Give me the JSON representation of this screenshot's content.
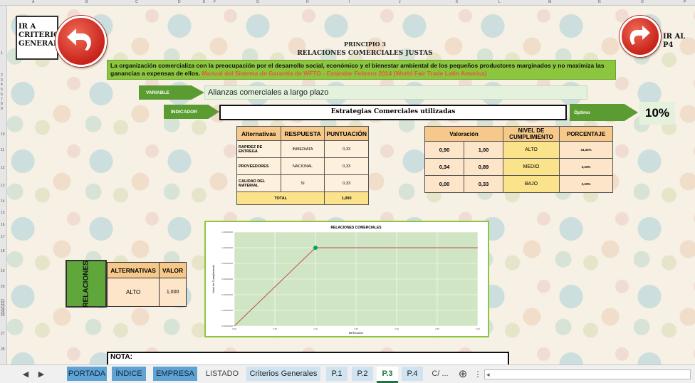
{
  "columns": [
    "A",
    "B",
    "C",
    "D",
    "E",
    "F",
    "G",
    "H",
    "I",
    "J",
    "K",
    "L",
    "M",
    "N",
    "O",
    "P"
  ],
  "rows": [
    "1",
    "2",
    "3",
    "4",
    "5",
    "6",
    "7",
    "8",
    "9",
    "10",
    "11",
    "12",
    "13",
    "14",
    "15",
    "16",
    "17",
    "18",
    "19",
    "20",
    "21",
    "22",
    "23",
    "24",
    "25",
    "26",
    "27",
    "28"
  ],
  "nav": {
    "left_label": "IR A CRITERIOS GENERALES",
    "right_label": "IR AL P4"
  },
  "header": {
    "principle": "PRINCIPIO 3",
    "title": "RELACIONES COMERCIALES JUSTAS"
  },
  "description": {
    "text": "La organización comercializa con la preocupación por el desarrollo social, económico y el bienestar ambiental de los pequeños productores marginados y no maximiza las ganancias a expensas de ellos.",
    "reference": " Manual del Sistema de Garantía de WFTO - Estándar Febrero 2014 (World Fair Trade Latin America)"
  },
  "variable": {
    "label": "VARIABLE",
    "value": "Alianzas comerciales a largo plazo"
  },
  "indicator": {
    "label": "INDICADOR",
    "value": "Estrategias Comerciales utilizadas",
    "optimo_label": "Óptimo",
    "optimo_value": "10%"
  },
  "alternatives_table": {
    "headers": [
      "Alternativas",
      "RESPUESTA",
      "PUNTUACIÓN"
    ],
    "rows": [
      {
        "alt": "RAPIDEZ DE ENTREGA",
        "resp": "INMEDIATA",
        "score": "0,33"
      },
      {
        "alt": "PROVEEDORES",
        "resp": "NACIONAL",
        "score": "0,33"
      },
      {
        "alt": "CALIDAD DEL MATERIAL",
        "resp": "SI",
        "score": "0,33"
      }
    ],
    "total_label": "TOTAL",
    "total_value": "1,000"
  },
  "valuation_table": {
    "headers": [
      "Valoración",
      "NIVEL DE CUMPLIMIENTO",
      "PORCENTAJE"
    ],
    "rows": [
      {
        "from": "0,90",
        "to": "1,00",
        "level": "ALTO",
        "pct": "33,33%"
      },
      {
        "from": "0,34",
        "to": "0,89",
        "level": "MEDIO",
        "pct": "3,33%"
      },
      {
        "from": "0,00",
        "to": "0,33",
        "level": "BAJO",
        "pct": "3,33%"
      }
    ]
  },
  "summary_table": {
    "side_label": "RELACIONES",
    "headers": [
      "ALTERNATIVAS",
      "VALOR"
    ],
    "level": "ALTO",
    "value": "1,000"
  },
  "chart_data": {
    "type": "line",
    "title": "RELACIONES COMERCIALES",
    "xlabel": "MERCADO",
    "ylabel": "Nivel de Cumplimiento",
    "x": [
      0,
      0.5,
      1,
      1.5,
      2,
      2.5,
      3
    ],
    "x_ticks": [
      "0,00",
      "0,50",
      "1,00",
      "1,50",
      "2,00",
      "2,50",
      "3,00"
    ],
    "y_ticks": [
      "0,00000000",
      "0,20000000",
      "0,40000000",
      "0,60000000",
      "0,80000000",
      "1,00000000",
      "1,20000000"
    ],
    "series": [
      {
        "values": [
          0,
          0.5,
          1,
          1,
          1,
          1,
          1
        ],
        "color": "#c0504d"
      }
    ],
    "marker": {
      "x": 1,
      "y": 1,
      "color": "#00a651"
    },
    "ylim": [
      0,
      1.2
    ],
    "xlim": [
      0,
      3
    ],
    "grid": true,
    "plot_bg": "#cfe5c4"
  },
  "note_label": "NOTA:",
  "tabs": [
    "PORTADA",
    "ÍNDICE",
    "EMPRESA",
    "LISTADO",
    "Criterios Generales",
    "P.1",
    "P.2",
    "P.3",
    "P.4",
    "C/ ..."
  ],
  "active_tab": "P.3"
}
